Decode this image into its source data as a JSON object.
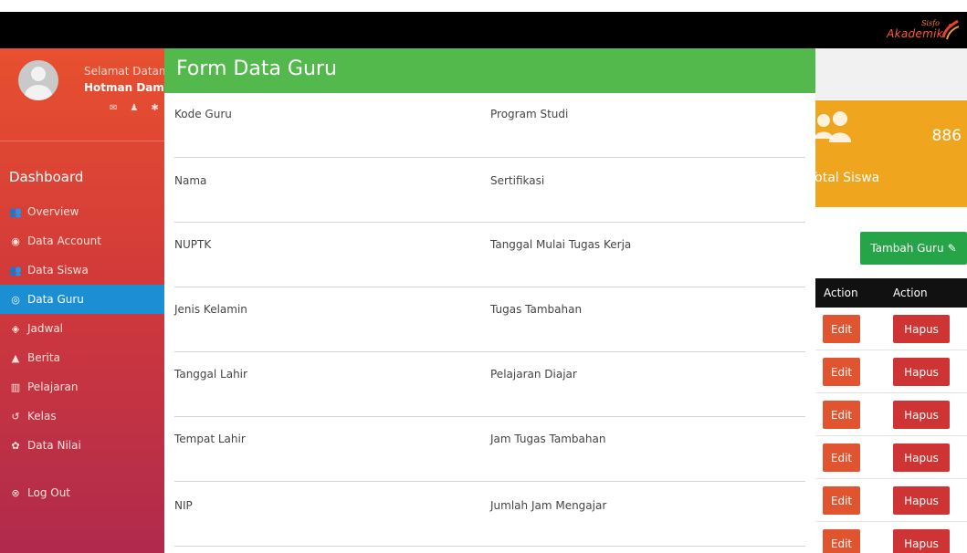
{
  "app": {
    "logo_small": "Sisfo",
    "logo_main": "Akademik"
  },
  "sidebar": {
    "welcome": "Selamat Datang",
    "username": "Hotman Damanik",
    "section_title": "Dashboard",
    "items": [
      {
        "label": "Overview",
        "icon": "users-icon"
      },
      {
        "label": "Data Account",
        "icon": "eye-icon"
      },
      {
        "label": "Data Siswa",
        "icon": "users-icon"
      },
      {
        "label": "Data Guru",
        "icon": "dot-circle-icon",
        "active": true
      },
      {
        "label": "Jadwal",
        "icon": "diamond-icon"
      },
      {
        "label": "Berita",
        "icon": "bell-icon"
      },
      {
        "label": "Pelajaran",
        "icon": "bank-icon"
      },
      {
        "label": "Kelas",
        "icon": "history-icon"
      },
      {
        "label": "Data Nilai",
        "icon": "gear-icon"
      }
    ],
    "logout": "Log Out"
  },
  "dashboard": {
    "stat_value": "886",
    "stat_label": "Total Siswa",
    "add_button": "Tambah Guru",
    "table_headers": [
      "Action",
      "Action"
    ],
    "row_edit": "Edit",
    "row_delete": "Hapus"
  },
  "modal": {
    "title": "Form Data Guru",
    "fields": [
      {
        "left": "Kode Guru",
        "right": "Program Studi"
      },
      {
        "left": "Nama",
        "right": "Sertifikasi"
      },
      {
        "left": "NUPTK",
        "right": "Tanggal Mulai Tugas Kerja"
      },
      {
        "left": "Jenis Kelamin",
        "right": "Tugas Tambahan"
      },
      {
        "left": "Tanggal Lahir",
        "right": "Pelajaran Diajar"
      },
      {
        "left": "Tempat Lahir",
        "right": "Jam Tugas Tambahan"
      },
      {
        "left": "NIP",
        "right": "Jumlah Jam Mengajar"
      }
    ]
  },
  "colors": {
    "modal_header": "#53b94c",
    "active_nav": "#1c8fd4",
    "stat_card": "#f0a51e",
    "edit_button": "#e0542f",
    "delete_button": "#cf3434",
    "add_button": "#26a548"
  }
}
